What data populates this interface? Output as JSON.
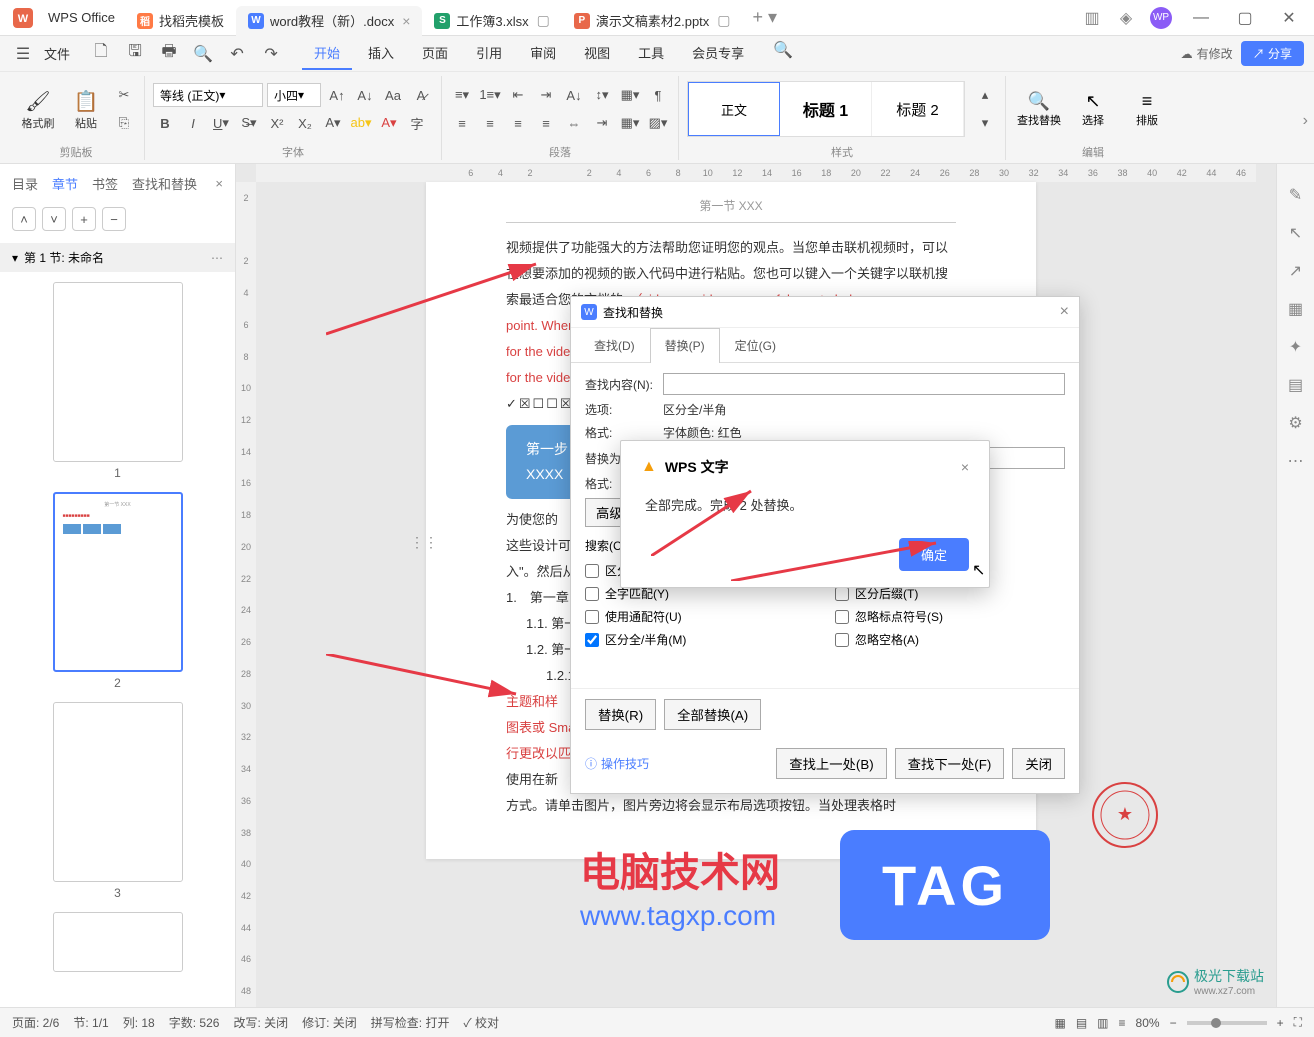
{
  "app": {
    "name": "WPS Office"
  },
  "tabs": [
    {
      "icon_bg": "#ff7a45",
      "icon": "稻",
      "label": "找稻壳模板"
    },
    {
      "icon_bg": "#4a7dff",
      "icon": "W",
      "label": "word教程（新）.docx",
      "active": true
    },
    {
      "icon_bg": "#22a06b",
      "icon": "S",
      "label": "工作簿3.xlsx"
    },
    {
      "icon_bg": "#e8684a",
      "icon": "P",
      "label": "演示文稿素材2.pptx"
    }
  ],
  "menubar": {
    "file": "文件",
    "modified": "有修改",
    "share": "分享",
    "tabs": [
      "开始",
      "插入",
      "页面",
      "引用",
      "审阅",
      "视图",
      "工具",
      "会员专享"
    ]
  },
  "ribbon": {
    "clipboard": {
      "format_painter": "格式刷",
      "paste": "粘贴",
      "group": "剪贴板"
    },
    "font": {
      "family": "等线 (正文)",
      "size": "小四",
      "group": "字体"
    },
    "paragraph": {
      "group": "段落"
    },
    "styles": {
      "normal": "正文",
      "h1": "标题 1",
      "h2": "标题 2",
      "group": "样式"
    },
    "editing": {
      "find": "查找替换",
      "select": "选择",
      "arrange": "排版",
      "group": "编辑"
    }
  },
  "sidebar": {
    "tabs": {
      "toc": "目录",
      "sections": "章节",
      "bookmarks": "书签",
      "find": "查找和替换"
    },
    "section_header": "第 1 节: 未命名",
    "thumbs": [
      "1",
      "2",
      "3"
    ]
  },
  "ruler_h": [
    "6",
    "4",
    "2",
    "",
    "2",
    "4",
    "6",
    "8",
    "10",
    "12",
    "14",
    "16",
    "18",
    "20",
    "22",
    "24",
    "26",
    "28",
    "30",
    "32",
    "34",
    "36",
    "38",
    "40",
    "42",
    "44",
    "46"
  ],
  "ruler_v": [
    "2",
    "",
    "2",
    "4",
    "6",
    "8",
    "10",
    "12",
    "14",
    "16",
    "18",
    "20",
    "22",
    "24",
    "26",
    "28",
    "30",
    "32",
    "34",
    "36",
    "38",
    "40",
    "42",
    "44",
    "46",
    "48"
  ],
  "page": {
    "header": "第一节 XXX",
    "para1": "视频提供了功能强大的方法帮助您证明您的观点。当您单击联机视频时，可以在想要添加的视频的嵌入代码中进行粘贴。您也可以键入一个关键字以联机搜索最适合您的文档的。",
    "para1_en": "（video provides a powerful way to help you prove your point. When you click the online video, you can paste in the embedding code for the video you want to add. You can also type a keyword to search online for the video that best fits your document。）",
    "checkboxes": "✓☒☐☐☒☒✓☐☐☐",
    "blue_l1": "第一步：",
    "blue_l2": "XXXX",
    "para2_a": "为使您的",
    "para2_b": "这些设计可",
    "para2_c": "入\"。然后从",
    "list1": "1.　第一章",
    "list2": "1.1. 第一",
    "list3": "1.2. 第一",
    "list4": "1.2.1",
    "para3_a": "主题和样",
    "para3_b": "图表或 Sma",
    "para3_c": "行更改以匹配",
    "para4": "使用在新",
    "para5": "方式。请单击图片，图片旁边将会显示布局选项按钮。当处理表格时"
  },
  "dialog": {
    "title": "查找和替换",
    "tabs": {
      "find": "查找(D)",
      "replace": "替换(P)",
      "goto": "定位(G)"
    },
    "find_label": "查找内容(N):",
    "options_label": "选项:",
    "options_value": "区分全/半角",
    "format_label": "格式:",
    "format_value": "字体颜色: 红色",
    "replace_label": "替换为(I):",
    "format2_label": "格式:",
    "advanced": "高级搜",
    "search_label": "搜索(C)",
    "checks": {
      "case": "区分",
      "whole": "全字匹配(Y)",
      "wildcard": "使用通配符(U)",
      "fullhalf": "区分全/半角(M)",
      "suffix": "区分后缀(T)",
      "punct": "忽略标点符号(S)",
      "space": "忽略空格(A)"
    },
    "btn_replace": "替换(R)",
    "btn_replace_all": "全部替换(A)",
    "tips": "操作技巧",
    "btn_prev": "查找上一处(B)",
    "btn_next": "查找下一处(F)",
    "btn_close": "关闭"
  },
  "alert": {
    "title": "WPS 文字",
    "message": "全部完成。完成 2 处替换。",
    "ok": "确定"
  },
  "statusbar": {
    "page": "页面: 2/6",
    "section": "节: 1/1",
    "line": "列: 18",
    "words": "字数: 526",
    "track": "改写: 关闭",
    "revise": "修订: 关闭",
    "spell": "拼写检查: 打开",
    "proof": "校对",
    "zoom": "80%"
  },
  "watermark": {
    "tag": "TAG",
    "text1": "电脑技术网",
    "text2": "www.tagxp.com",
    "logo": "极光下载站",
    "logo_url": "www.xz7.com"
  }
}
